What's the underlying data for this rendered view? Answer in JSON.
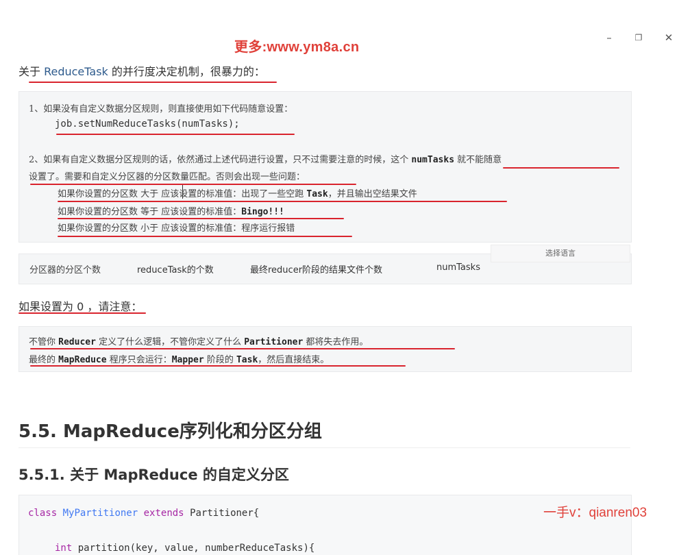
{
  "window": {
    "minimize_label": "–",
    "restore_label": "❐",
    "close_label": "✕"
  },
  "watermark": {
    "top": "更多:www.ym8a.cn",
    "bottom": "一手v：qianren03"
  },
  "section_reduce": {
    "heading_prefix": "关于 ",
    "heading_keyword": "ReduceTask",
    "heading_suffix": " 的并行度决定机制，很暴力的："
  },
  "block1": {
    "item1_text": "1、如果没有自定义数据分区规则，则直接使用如下代码随意设置：",
    "item1_code": "job.setNumReduceTasks(numTasks);",
    "item2_line1_a": "2、如果有自定义数据分区规则的话，依然通过上述代码进行设置，只不过需要注意的时候，这个 ",
    "item2_line1_code": "numTasks",
    "item2_line1_b": " 就不能随意",
    "item2_line2": "设置了。需要和自定义分区器的分区数量匹配。否则会出现一些问题：",
    "case_gt_a": "如果你设置的分区数 大于 应该设置的标准值：出现了一些空跑 ",
    "case_gt_code": "Task",
    "case_gt_b": "，并且输出空结果文件",
    "case_eq_a": "如果你设置的分区数 等于 应该设置的标准值：",
    "case_eq_code": "Bingo!!!",
    "case_lt": "如果你设置的分区数 小于 应该设置的标准值：程序运行报错"
  },
  "table_strip": {
    "col1": "分区器的分区个数",
    "col2": "reduceTask的个数",
    "col3": "最终reducer阶段的结果文件个数",
    "col4": "numTasks",
    "lang_label": "选择语言"
  },
  "section_zero": {
    "heading": "如果设置为 0 ，请注意："
  },
  "block2": {
    "line1_a": "不管你 ",
    "line1_code1": "Reducer",
    "line1_b": " 定义了什么逻辑，不管你定义了什么 ",
    "line1_code2": "Partitioner",
    "line1_c": " 都将失去作用。",
    "line2_a": "最终的 ",
    "line2_code1": "MapReduce",
    "line2_b": " 程序只会运行：",
    "line2_code2": "Mapper",
    "line2_c": " 阶段的 ",
    "line2_code3": "Task",
    "line2_d": "，然后直接结束。"
  },
  "section_55": {
    "title": "5.5. MapReduce序列化和分区分组"
  },
  "section_551": {
    "title": "5.5.1. 关于 MapReduce 的自定义分区"
  },
  "code_sample": {
    "line1_kw": "class",
    "line1_cls": "MyPartitioner",
    "line1_kw2": "extends",
    "line1_rest": "Partitioner{",
    "line2_type": "int",
    "line2_rest": "partition(key, value, numberReduceTasks){"
  },
  "colors": {
    "annotation_red": "#d9232d",
    "watermark_red": "#e0413a",
    "block_bg": "#f5f6f7"
  }
}
